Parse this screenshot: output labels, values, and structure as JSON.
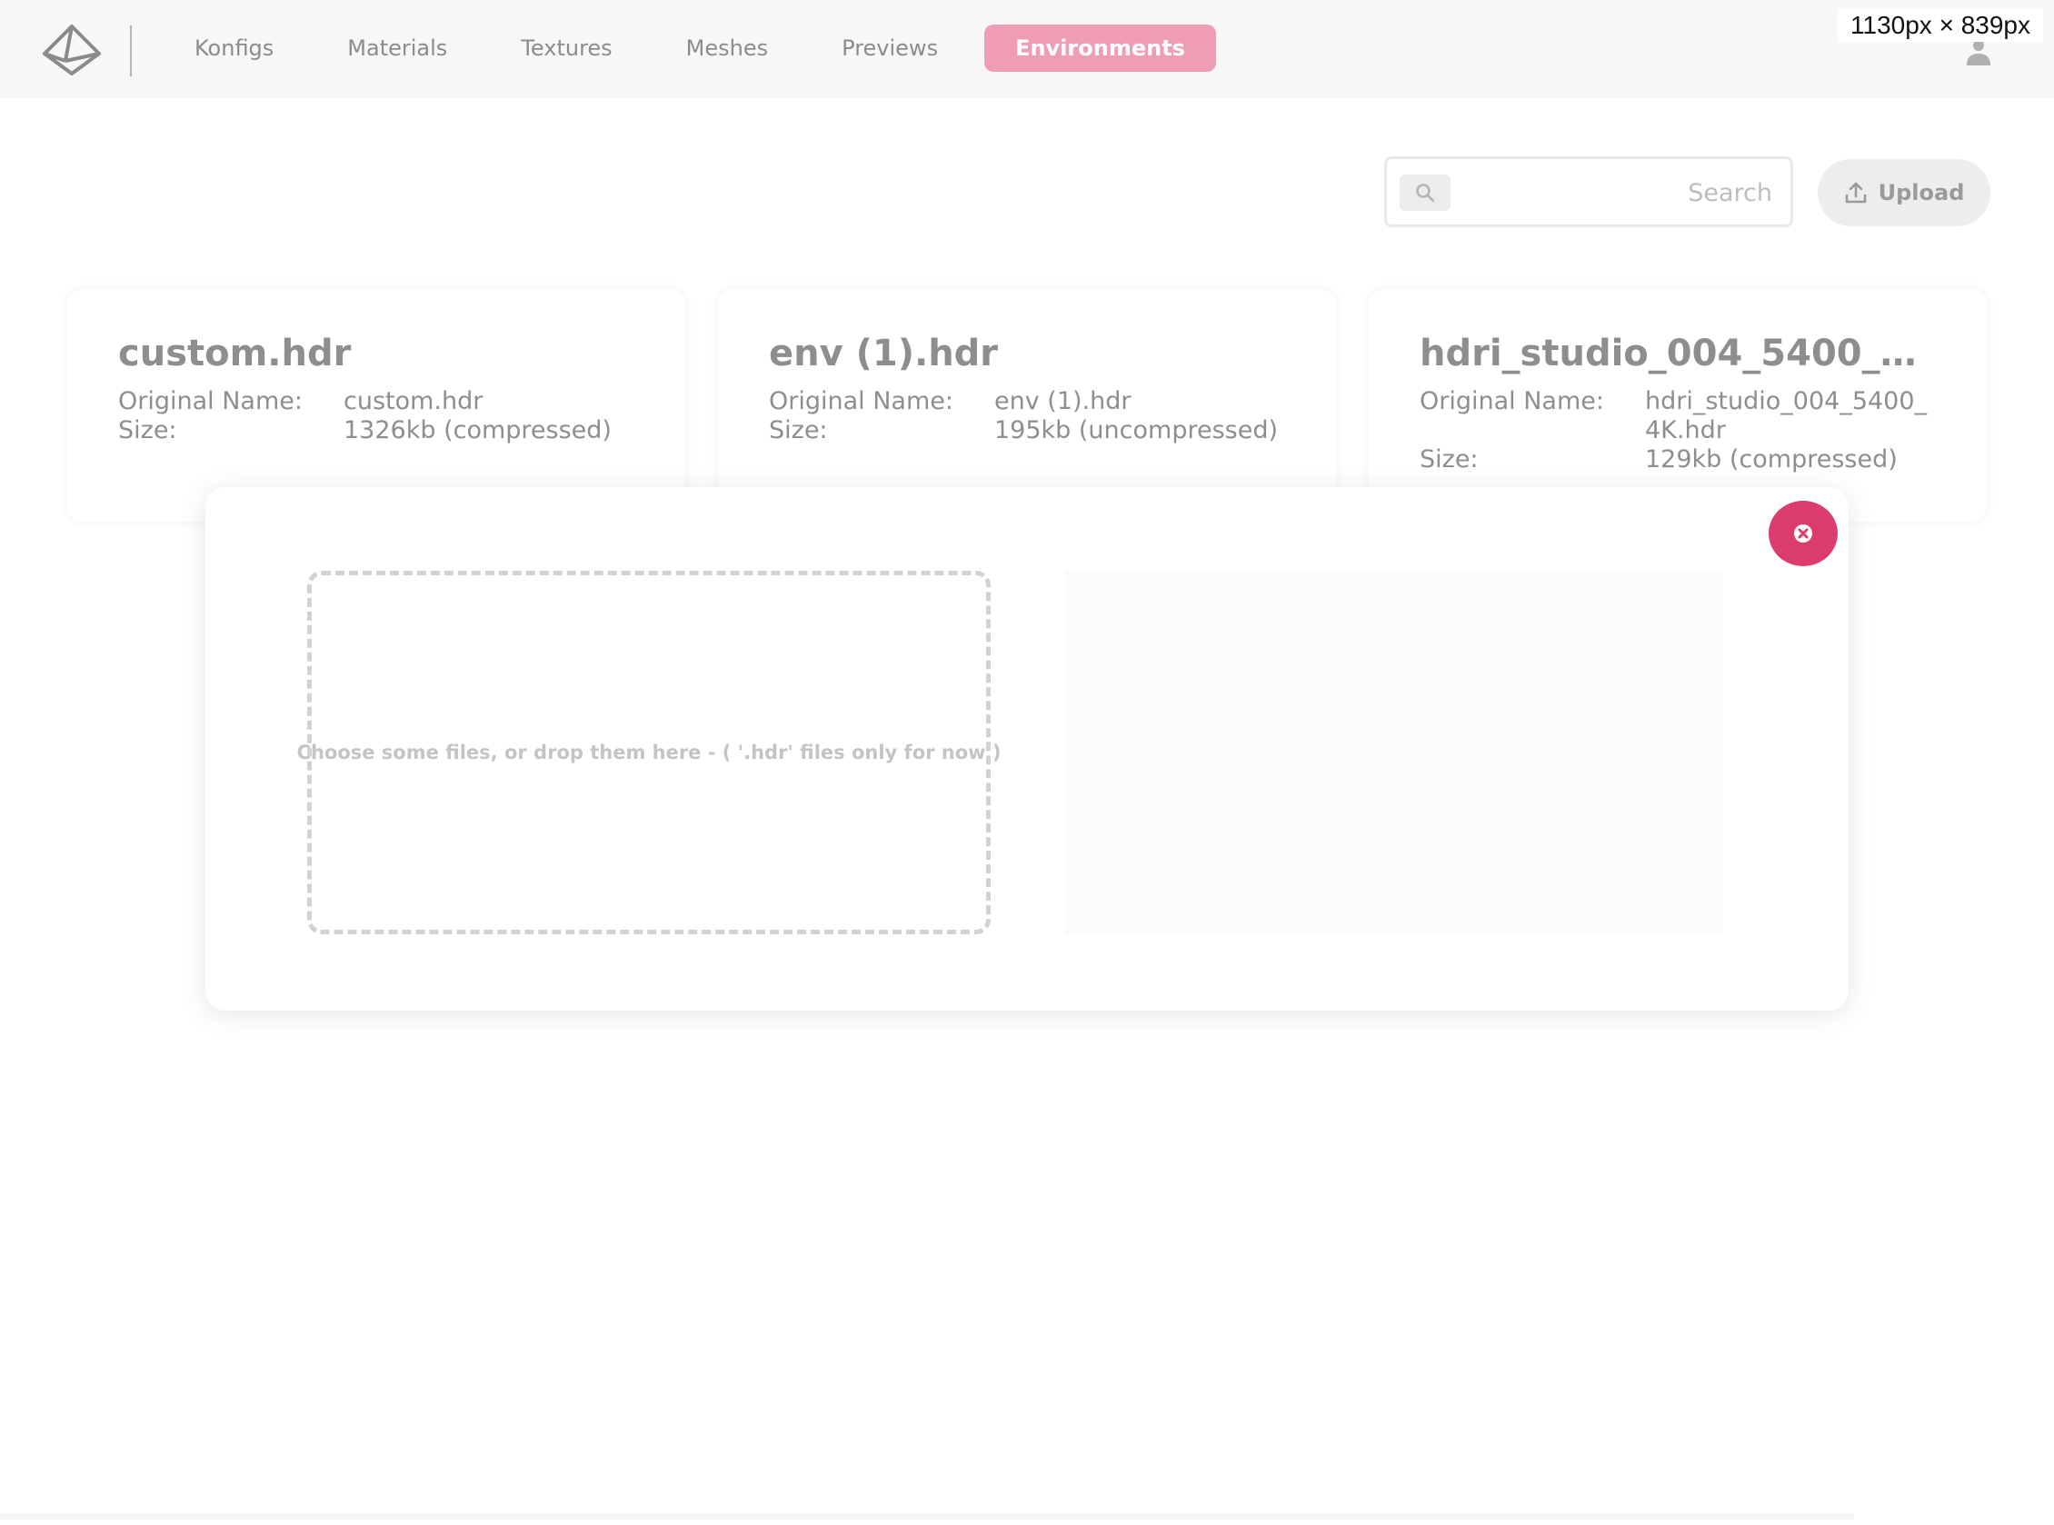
{
  "viewport_label": "1130px × 839px",
  "nav": {
    "items": [
      {
        "label": "Konfigs"
      },
      {
        "label": "Materials"
      },
      {
        "label": "Textures"
      },
      {
        "label": "Meshes"
      },
      {
        "label": "Previews"
      },
      {
        "label": "Environments",
        "active": true
      }
    ]
  },
  "search": {
    "placeholder": "Search",
    "value": ""
  },
  "upload": {
    "label": "Upload"
  },
  "meta_labels": {
    "original_name": "Original Name:",
    "size": "Size:"
  },
  "cards": [
    {
      "title": "custom.hdr",
      "original_name": "custom.hdr",
      "size": "1326kb (compressed)"
    },
    {
      "title": "env (1).hdr",
      "original_name": "env (1).hdr",
      "size": "195kb (uncompressed)"
    },
    {
      "title": "hdri_studio_004_5400_4K.hdr",
      "original_name": "hdri_studio_004_5400_4K.hdr",
      "size": "129kb (compressed)"
    }
  ],
  "modal": {
    "dropzone_text": "Choose some files, or drop them here - ( '.hdr' files only for now )"
  },
  "icons": {
    "logo": "pyramid-logo-icon",
    "user": "user-icon",
    "search": "search-icon",
    "upload": "upload-icon",
    "close": "close-icon"
  },
  "colors": {
    "accent": "#ee9db4",
    "close": "#dc3c6b",
    "header_bg": "#f7f7f7"
  }
}
